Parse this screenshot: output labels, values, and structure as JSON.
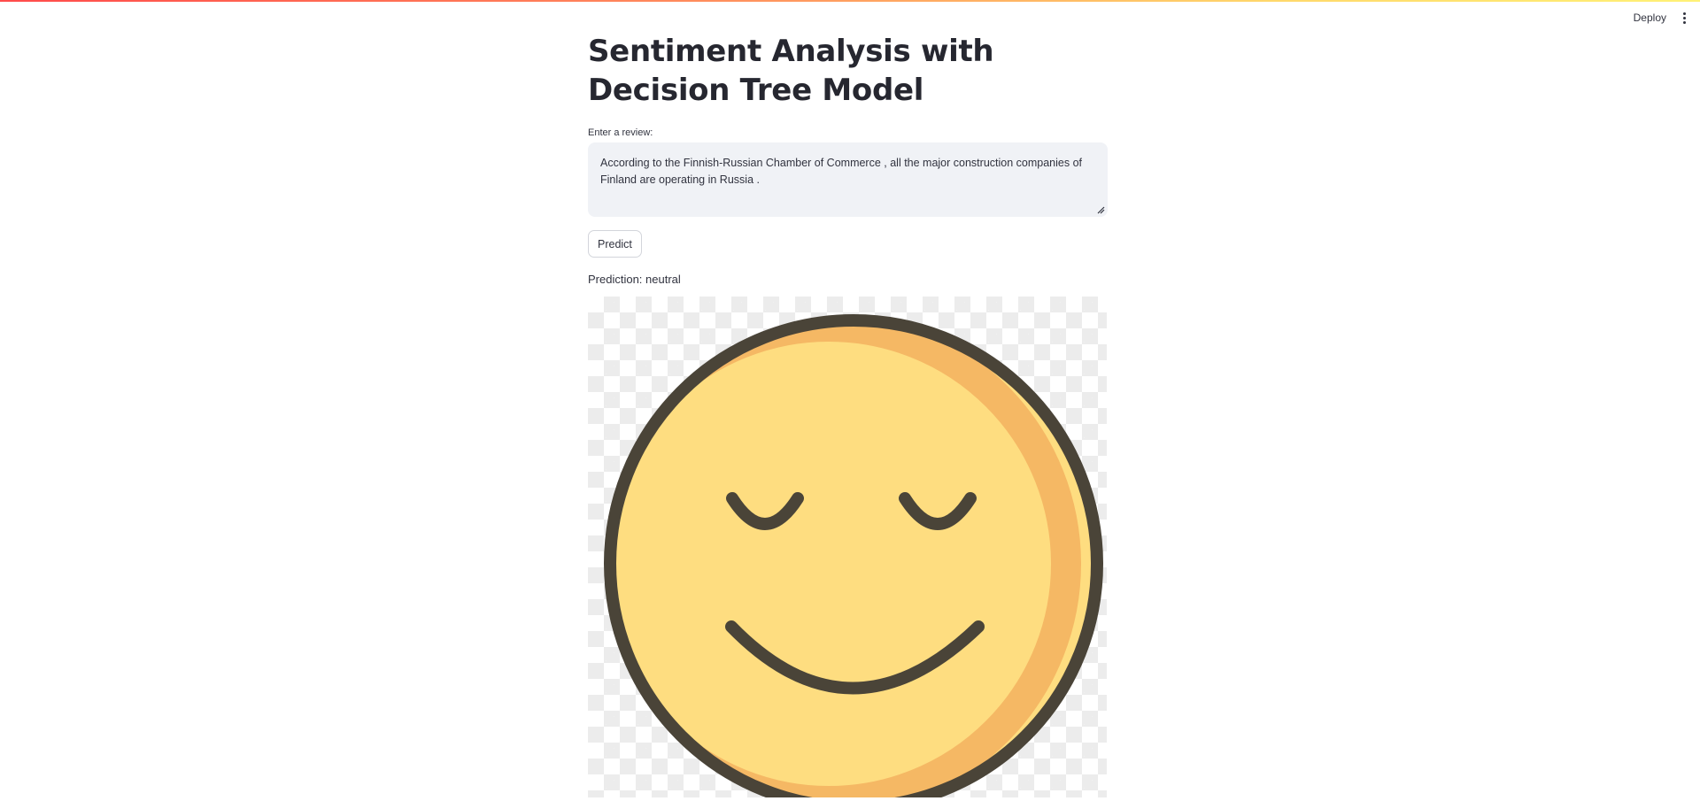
{
  "header": {
    "deploy_label": "Deploy",
    "menu_icon": "kebab-menu-icon"
  },
  "main": {
    "title": "Sentiment Analysis with Decision Tree Model",
    "review_input": {
      "label": "Enter a review:",
      "value": "According to the Finnish-Russian Chamber of Commerce , all the major construction companies of Finland are operating in Russia ."
    },
    "predict_button_label": "Predict",
    "prediction_text": "Prediction: neutral",
    "result_image_icon": "neutral-smiley-face-icon"
  },
  "colors": {
    "face_fill": "#fedd80",
    "face_shade": "#f5b864",
    "face_outline": "#4a4438",
    "top_gradient_start": "#ff4b4b",
    "top_gradient_end": "#fff176",
    "input_background": "#f0f2f6"
  }
}
